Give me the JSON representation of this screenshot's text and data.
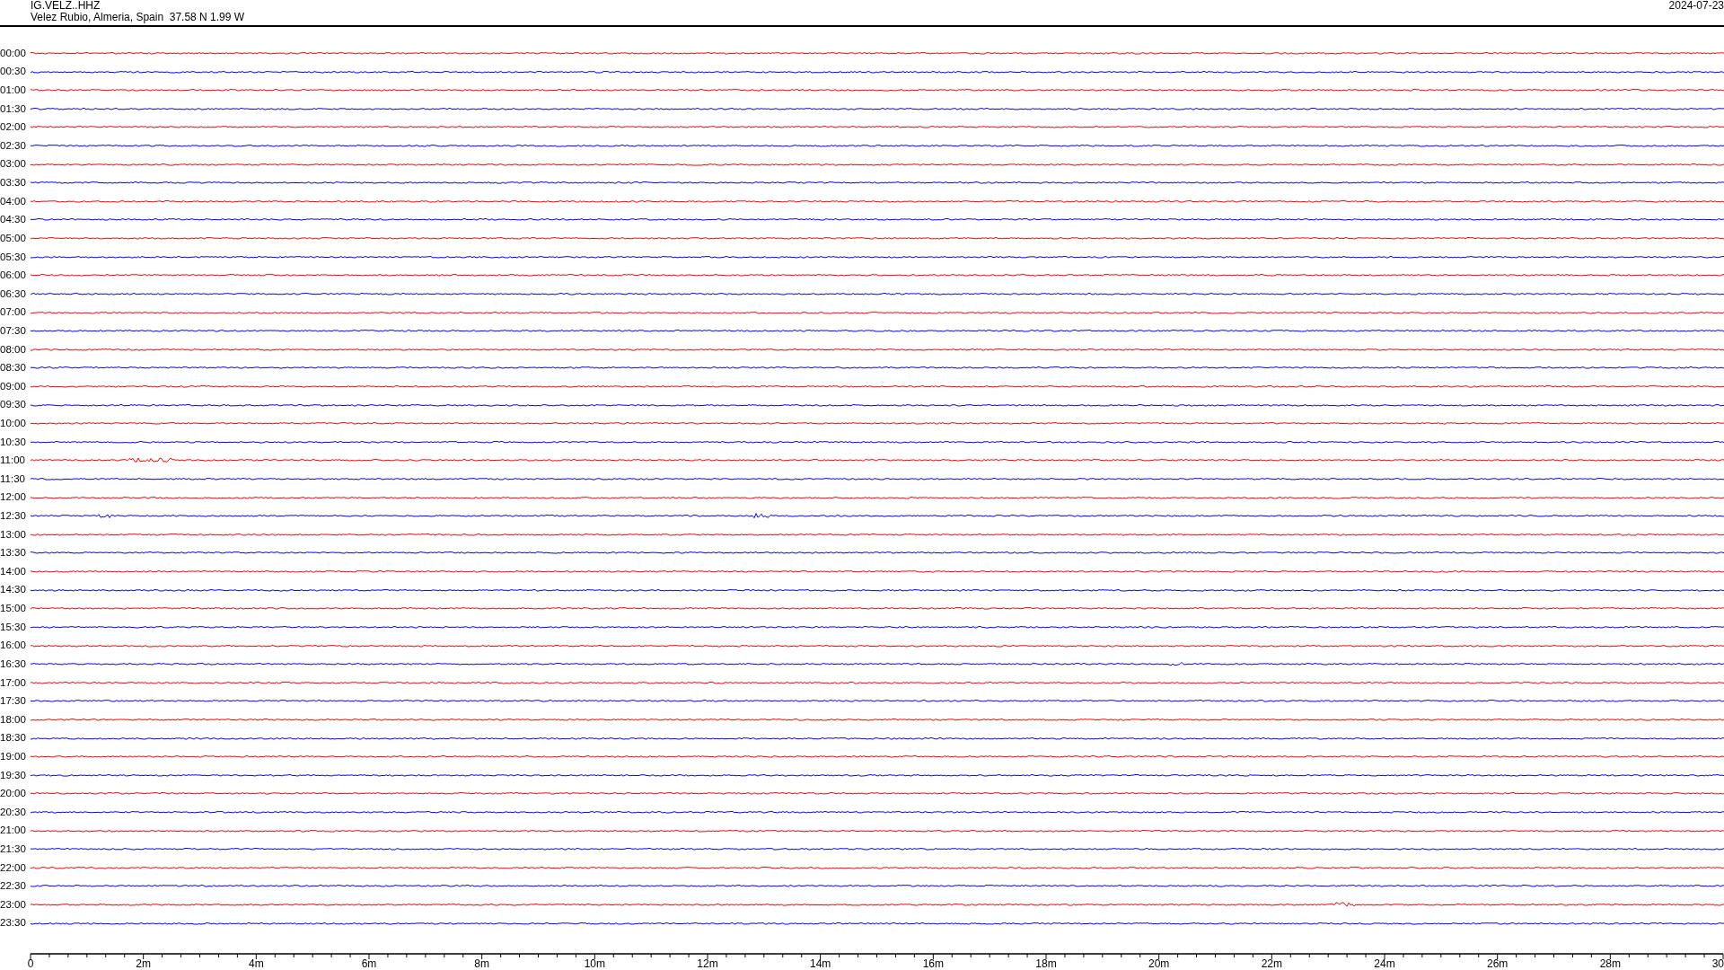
{
  "header": {
    "station": "IG.VELZ..HHZ",
    "location": "Velez Rubio, Almeria, Spain  37.58 N 1.99 W",
    "date": "2024-07-23"
  },
  "traces": [
    {
      "time": "00:00",
      "color": "#ff0000"
    },
    {
      "time": "00:30",
      "color": "#0000ff"
    },
    {
      "time": "01:00",
      "color": "#ff0000"
    },
    {
      "time": "01:30",
      "color": "#0000ff"
    },
    {
      "time": "02:00",
      "color": "#ff0000"
    },
    {
      "time": "02:30",
      "color": "#0000ff"
    },
    {
      "time": "03:00",
      "color": "#ff0000"
    },
    {
      "time": "03:30",
      "color": "#0000ff"
    },
    {
      "time": "04:00",
      "color": "#ff0000"
    },
    {
      "time": "04:30",
      "color": "#0000ff"
    },
    {
      "time": "05:00",
      "color": "#ff0000"
    },
    {
      "time": "05:30",
      "color": "#0000ff"
    },
    {
      "time": "06:00",
      "color": "#ff0000"
    },
    {
      "time": "06:30",
      "color": "#0000ff"
    },
    {
      "time": "07:00",
      "color": "#ff0000"
    },
    {
      "time": "07:30",
      "color": "#0000ff"
    },
    {
      "time": "08:00",
      "color": "#ff0000"
    },
    {
      "time": "08:30",
      "color": "#0000ff"
    },
    {
      "time": "09:00",
      "color": "#ff0000"
    },
    {
      "time": "09:30",
      "color": "#0000ff"
    },
    {
      "time": "10:00",
      "color": "#ff0000"
    },
    {
      "time": "10:30",
      "color": "#0000ff"
    },
    {
      "time": "11:00",
      "color": "#ff0000"
    },
    {
      "time": "11:30",
      "color": "#0000ff"
    },
    {
      "time": "12:00",
      "color": "#ff0000"
    },
    {
      "time": "12:30",
      "color": "#0000ff"
    },
    {
      "time": "13:00",
      "color": "#ff0000"
    },
    {
      "time": "13:30",
      "color": "#0000ff"
    },
    {
      "time": "14:00",
      "color": "#ff0000"
    },
    {
      "time": "14:30",
      "color": "#0000ff"
    },
    {
      "time": "15:00",
      "color": "#ff0000"
    },
    {
      "time": "15:30",
      "color": "#0000ff"
    },
    {
      "time": "16:00",
      "color": "#ff0000"
    },
    {
      "time": "16:30",
      "color": "#0000ff"
    },
    {
      "time": "17:00",
      "color": "#ff0000"
    },
    {
      "time": "17:30",
      "color": "#0000ff"
    },
    {
      "time": "18:00",
      "color": "#ff0000"
    },
    {
      "time": "18:30",
      "color": "#0000ff"
    },
    {
      "time": "19:00",
      "color": "#ff0000"
    },
    {
      "time": "19:30",
      "color": "#0000ff"
    },
    {
      "time": "20:00",
      "color": "#ff0000"
    },
    {
      "time": "20:30",
      "color": "#0000ff"
    },
    {
      "time": "21:00",
      "color": "#ff0000"
    },
    {
      "time": "21:30",
      "color": "#0000ff"
    },
    {
      "time": "22:00",
      "color": "#ff0000"
    },
    {
      "time": "22:30",
      "color": "#0000ff"
    },
    {
      "time": "23:00",
      "color": "#ff0000"
    },
    {
      "time": "23:30",
      "color": "#0000ff"
    }
  ],
  "axis": {
    "ticks": [
      "0",
      "2m",
      "4m",
      "6m",
      "8m",
      "10m",
      "12m",
      "14m",
      "16m",
      "18m",
      "20m",
      "22m",
      "24m",
      "26m",
      "28m",
      "30"
    ]
  }
}
